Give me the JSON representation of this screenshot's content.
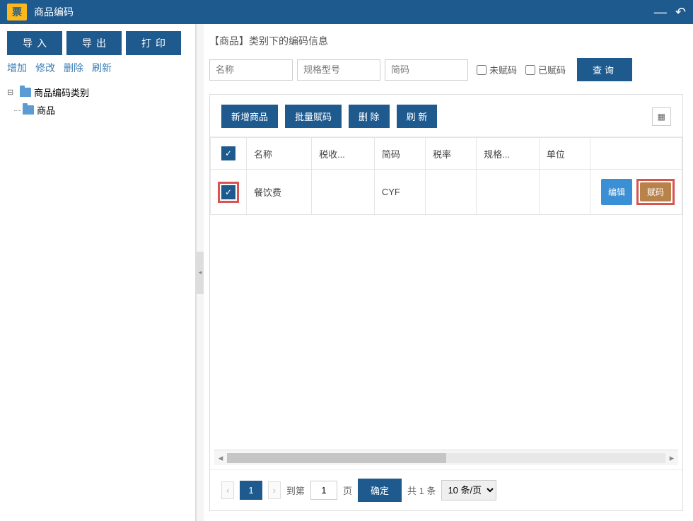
{
  "titlebar": {
    "logo": "票",
    "title": "商品编码"
  },
  "sidebar": {
    "buttons": {
      "import": "导入",
      "export": "导出",
      "print": "打印"
    },
    "links": {
      "add": "增加",
      "modify": "修改",
      "delete": "删除",
      "refresh": "刷新"
    },
    "tree": {
      "root": "商品编码类别",
      "child": "商品"
    }
  },
  "main": {
    "title": "【商品】类别下的编码信息",
    "search": {
      "name_ph": "名称",
      "spec_ph": "规格型号",
      "short_ph": "简码",
      "unassigned": "未赋码",
      "assigned": "已赋码",
      "query": "查询"
    },
    "actions": {
      "add_product": "新增商品",
      "batch_code": "批量赋码",
      "delete": "删 除",
      "refresh": "刷 新"
    },
    "columns": [
      "名称",
      "税收...",
      "简码",
      "税率",
      "规格...",
      "单位"
    ],
    "rows": [
      {
        "name": "餐饮费",
        "tax": "",
        "short": "CYF",
        "rate": "",
        "spec": "",
        "unit": ""
      }
    ],
    "row_buttons": {
      "edit": "编辑",
      "code": "赋码"
    },
    "pager": {
      "current": "1",
      "goto_label": "到第",
      "goto_value": "1",
      "page_label": "页",
      "ok": "确定",
      "total": "共 1 条",
      "per_page": "10 条/页"
    }
  }
}
